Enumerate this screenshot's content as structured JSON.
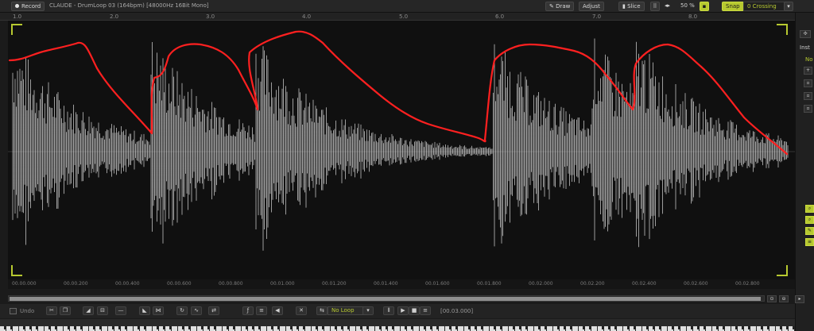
{
  "topbar": {
    "record_label": "Record",
    "title": "CLAUDE - DrumLoop 03 (164bpm) [48000Hz 16Bit Mono]",
    "draw_label": "Draw",
    "adjust_label": "Adjust",
    "slice_label": "Slice",
    "zoom_value": "50 %",
    "snap_label": "Snap",
    "crossing_label": "0 Crossing"
  },
  "ruler": [
    "1.0",
    "2.0",
    "3.0",
    "4.0",
    "5.0",
    "6.0",
    "7.0",
    "8.0"
  ],
  "timeline": [
    "00.00.000",
    "00.00.200",
    "00.00.400",
    "00.00.600",
    "00.00.800",
    "00.01.000",
    "00.01.200",
    "00.01.400",
    "00.01.600",
    "00.01.800",
    "00.02.000",
    "00.02.200",
    "00.02.400",
    "00.02.600",
    "00.02.800"
  ],
  "bottombar": {
    "undo_label": "Undo",
    "loop_value": "No Loop",
    "time_value": "[00.03.000]"
  },
  "right_panel": {
    "label_ins": "Inst",
    "label_no": "No"
  },
  "colors": {
    "accent": "#b7c930",
    "annotation": "#ff2020",
    "waveform": "#d8d8d8"
  }
}
